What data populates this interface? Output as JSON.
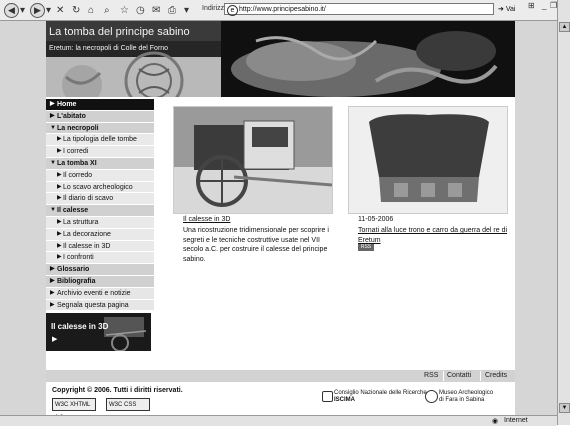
{
  "browser": {
    "address_label": "Indirizzo",
    "url": "http://www.principesabino.it/",
    "go_label": "Vai",
    "status_text": "Internet"
  },
  "header": {
    "title": "La tomba del principe sabino",
    "subtitle": "Eretum: la necropoli di Colle del Forno"
  },
  "nav": {
    "items": [
      {
        "label": "Home"
      },
      {
        "label": "L'abitato"
      },
      {
        "label": "La necropoli"
      },
      {
        "label": "La tipologia delle tombe"
      },
      {
        "label": "I corredi"
      },
      {
        "label": "La tomba XI"
      },
      {
        "label": "Il corredo"
      },
      {
        "label": "Lo scavo archeologico"
      },
      {
        "label": "Il diario di scavo"
      },
      {
        "label": "Il calesse"
      },
      {
        "label": "La struttura"
      },
      {
        "label": "La decorazione"
      },
      {
        "label": "Il calesse in 3D"
      },
      {
        "label": "I confronti"
      },
      {
        "label": "Glossario"
      },
      {
        "label": "Bibliografia"
      },
      {
        "label": "Archivio eventi e notizie"
      },
      {
        "label": "Segnala questa pagina"
      }
    ]
  },
  "promo": {
    "label": "Il calesse in 3D",
    "play": "▶"
  },
  "content": {
    "col1": {
      "title": "Il calesse in 3D",
      "text": "Una ricostruzione tridimensionale per scoprire i segreti e le tecniche costruttive usate nel VII secolo a.C. per costruire il calesse del principe sabino."
    },
    "col2": {
      "date": "11-05-2006",
      "title": "Tornati alla luce trono e carro da guerra del re di Eretum",
      "badge": "RSS"
    }
  },
  "footer": {
    "links": [
      "RSS",
      "Contatti",
      "Credits"
    ],
    "copyright": "Copyright © 2006. Tutti i diritti riservati.",
    "badges": [
      "W3C XHTML 1.0",
      "W3C CSS"
    ],
    "cnr": [
      "Consiglio Nazionale delle Ricerche",
      "ISCIMA"
    ],
    "museum": [
      "Museo Archeologico",
      "di Fara in Sabina"
    ]
  }
}
